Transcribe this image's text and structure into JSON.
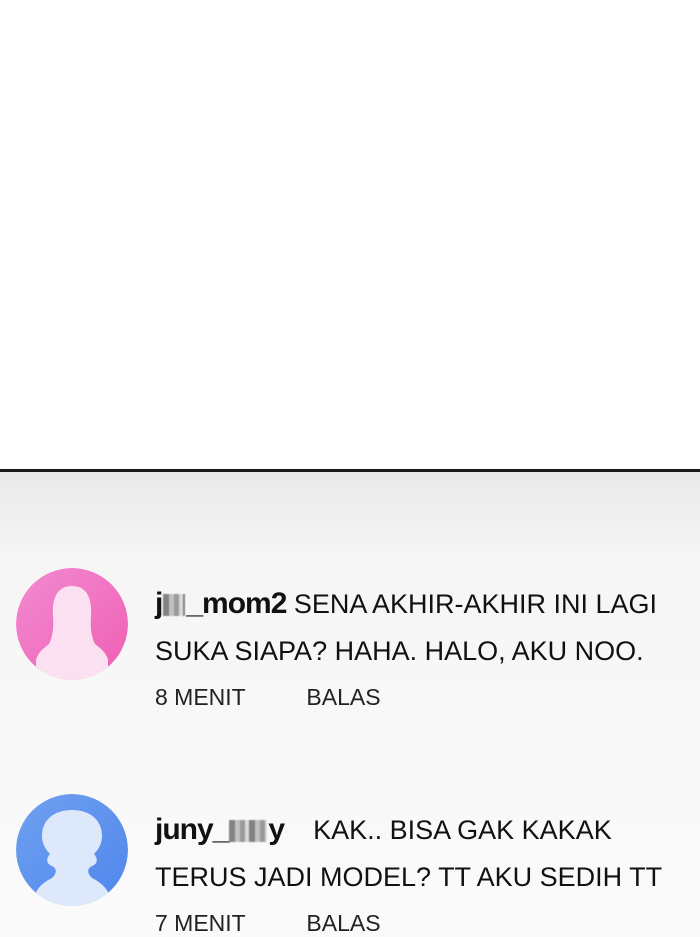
{
  "comments": [
    {
      "user_prefix": "j",
      "user_suffix": "_mom2",
      "text_line1": "SENA AKHIR-AKHIR INI LAGI",
      "text_line2": "SUKA SIAPA? HAHA. HALO, AKU NOO.",
      "time": "8 MENIT",
      "reply": "BALAS",
      "avatar_color": "#f06fc0",
      "avatar_icon": "female-silhouette-icon"
    },
    {
      "user_prefix": "juny_",
      "user_suffix": "y",
      "text_line1": "KAK.. BISA GAK KAKAK",
      "text_line2": "TERUS JADI MODEL? TT AKU SEDIH TT",
      "time": "7 MENIT",
      "reply": "BALAS",
      "avatar_color": "#5b93ef",
      "avatar_icon": "person-silhouette-icon"
    }
  ],
  "colors": {
    "divider": "#1a1a1a",
    "panel_background": "#f4f4f4",
    "text": "#111111"
  }
}
